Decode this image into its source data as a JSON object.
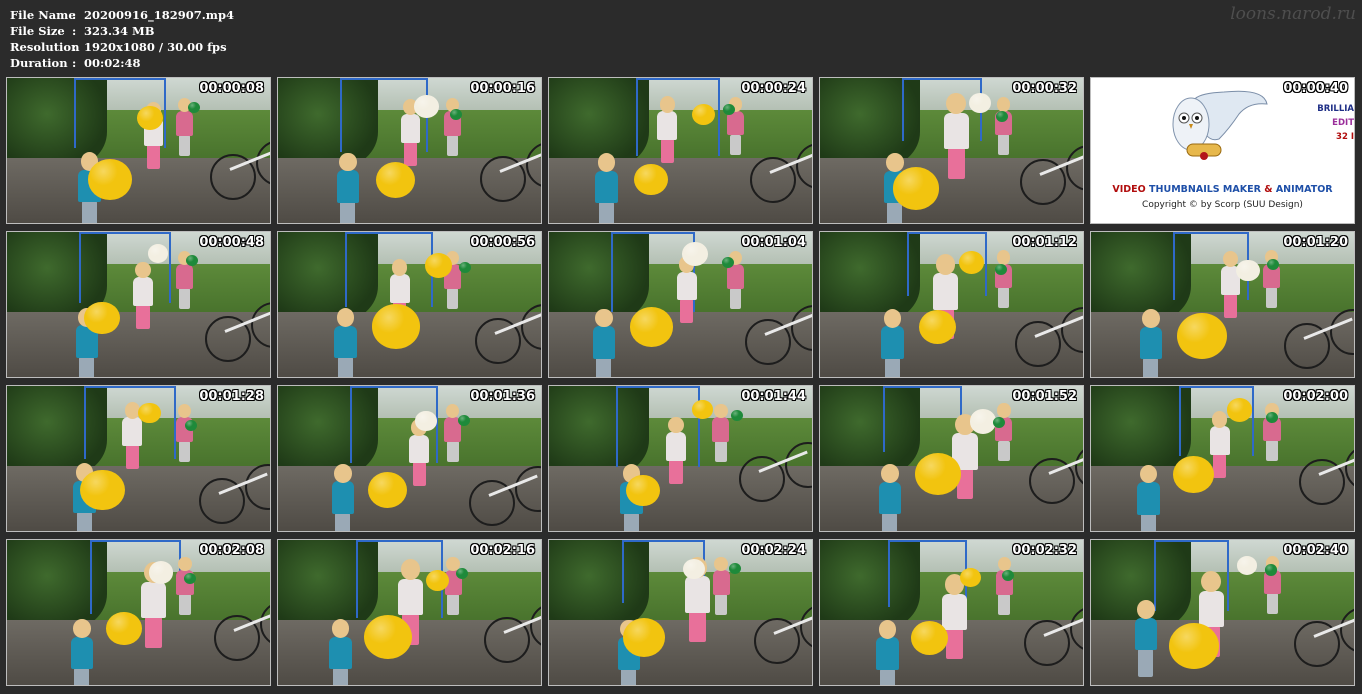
{
  "info": {
    "rows": [
      {
        "label": "File Name",
        "sep": ":",
        "value": "20200916_182907.mp4"
      },
      {
        "label": "File Size",
        "sep": ":",
        "value": "323.34 MB"
      },
      {
        "label": "Resolution",
        "sep": ":",
        "value": "1920x1080 / 30.00 fps"
      },
      {
        "label": "Duration",
        "sep": ":",
        "value": "00:02:48"
      }
    ]
  },
  "watermark": "loons.narod.ru",
  "thumbnails": [
    {
      "time": "00:00:08"
    },
    {
      "time": "00:00:16"
    },
    {
      "time": "00:00:24"
    },
    {
      "time": "00:00:32"
    },
    {
      "time": "00:00:40",
      "promo": true
    },
    {
      "time": "00:00:48"
    },
    {
      "time": "00:00:56"
    },
    {
      "time": "00:01:04"
    },
    {
      "time": "00:01:12"
    },
    {
      "time": "00:01:20"
    },
    {
      "time": "00:01:28"
    },
    {
      "time": "00:01:36"
    },
    {
      "time": "00:01:44"
    },
    {
      "time": "00:01:52"
    },
    {
      "time": "00:02:00"
    },
    {
      "time": "00:02:08"
    },
    {
      "time": "00:02:16"
    },
    {
      "time": "00:02:24"
    },
    {
      "time": "00:02:32"
    },
    {
      "time": "00:02:40"
    }
  ],
  "promo": {
    "title_red_1": "VIDEO",
    "title_blue_1": "THUMBNAILS MAKER",
    "title_red_2": "&",
    "title_blue_2": "ANIMATOR",
    "copyright": "Copyright © by Scorp (SUU Design)",
    "side_1": "BRILLIA",
    "side_2": "EDIT",
    "side_3": "32 I"
  },
  "colors": {
    "background": "#2b2b2b",
    "balloon_yellow": "#f2c40f",
    "balloon_white": "#f3efe2",
    "balloon_green": "#1e8a3a",
    "jacket_teal": "#1e8fb0",
    "pants_pink": "#e8709a"
  }
}
